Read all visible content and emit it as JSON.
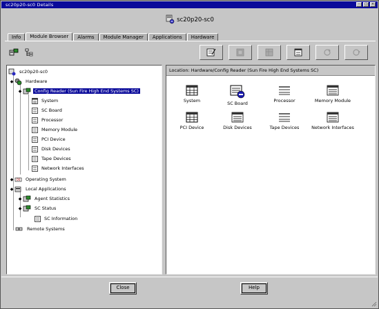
{
  "window": {
    "title": "sc20p20-sc0 Details",
    "host_name": "sc20p20-sc0"
  },
  "tabs": [
    {
      "label": "Info"
    },
    {
      "label": "Module Browser"
    },
    {
      "label": "Alarms"
    },
    {
      "label": "Module Manager"
    },
    {
      "label": "Applications"
    },
    {
      "label": "Hardware"
    }
  ],
  "active_tab": "Module Browser",
  "location": {
    "text": "Location:  Hardware/Config Reader (Sun Fire High End Systems SC)"
  },
  "tree": [
    {
      "label": "sc20p20-sc0"
    },
    {
      "label": "Hardware"
    },
    {
      "label": "Config Reader (Sun Fire High End Systems SC)"
    },
    {
      "label": "System"
    },
    {
      "label": "SC Board"
    },
    {
      "label": "Processor"
    },
    {
      "label": "Memory Module"
    },
    {
      "label": "PCI Device"
    },
    {
      "label": "Disk Devices"
    },
    {
      "label": "Tape Devices"
    },
    {
      "label": "Network Interfaces"
    },
    {
      "label": "Operating System"
    },
    {
      "label": "Local Applications"
    },
    {
      "label": "Agent Statistics"
    },
    {
      "label": "SC Status"
    },
    {
      "label": "SC Information"
    },
    {
      "label": "Remote Systems"
    }
  ],
  "grid": [
    {
      "label": "System"
    },
    {
      "label": "SC Board"
    },
    {
      "label": "Processor"
    },
    {
      "label": "Memory Module"
    },
    {
      "label": "PCI Device"
    },
    {
      "label": "Disk Devices"
    },
    {
      "label": "Tape Devices"
    },
    {
      "label": "Network Interfaces"
    }
  ],
  "buttons": {
    "close": "Close",
    "help": "Help"
  }
}
